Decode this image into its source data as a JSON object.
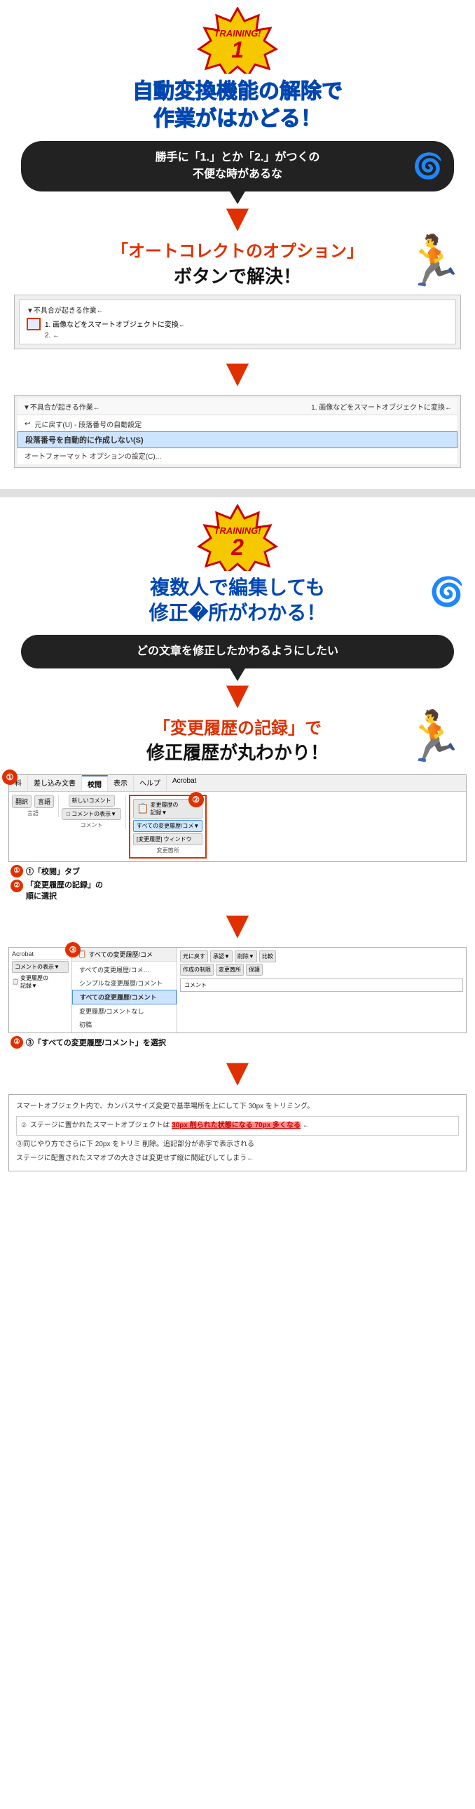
{
  "section1": {
    "badge": {
      "training_label": "TRAINING!",
      "number": "1"
    },
    "title_line1": "自動変換機能の解除で",
    "title_line2": "作業がはかどる！",
    "bubble_text_line1": "勝手に「1.」とか「2.」がつくの",
    "bubble_text_line2": "不便な時があるな",
    "arrow": "▼",
    "solution_line1": "「オートコレクトのオプション」",
    "solution_line2": "ボタンで解決！",
    "screenshot1": {
      "label": "▼不具合が起きる作業←",
      "row1": "1. 画像などをスマートオブジェクトに変換←",
      "row2": "2. ←"
    },
    "screenshot2": {
      "label": "▼不具合が起きる作業←",
      "row1": "1. 画像などをスマートオブジェクトに変換←",
      "menu_items": [
        {
          "text": "元に戻す(U) - 段落番号の自動設定",
          "highlighted": false
        },
        {
          "text": "段落番号を自動的に作成しない(S)",
          "highlighted": true
        },
        {
          "text": "オートフォーマット オプションの設定(C)...",
          "highlighted": false
        }
      ]
    }
  },
  "section2": {
    "badge": {
      "training_label": "TRAINING!",
      "number": "2"
    },
    "title_line1": "複数人で編集しても",
    "title_line2": "修正�所がわかる！",
    "bubble_text": "どの文章を修正したかわるようにしたい",
    "solution_line1": "「変更履歴の記録」で",
    "solution_line2": "修正履歴が丸わかり！",
    "toolbar": {
      "tabs": [
        "校閲",
        "差し込み文書",
        "校閲",
        "表示",
        "ヘルプ",
        "Acrobat"
      ],
      "active_tab": "校閲",
      "groups": {
        "language": {
          "label": "言語",
          "buttons": [
            "翻訳",
            "言語"
          ]
        },
        "comment": {
          "label": "コメント",
          "buttons": [
            "新しいコメント",
            "コメントの表示"
          ]
        },
        "track": {
          "label": "変更箇所",
          "buttons": [
            "変更履歴の記録▼",
            "すべての変更履歴/コメ…",
            "[変更履歴] ウィンドウ"
          ]
        }
      }
    },
    "annotation1": "①「校閲」タブ",
    "annotation2": "②「変更履歴の記録」の\n順に選択",
    "dropdown": {
      "title": "変更履歴の記録▼",
      "items": [
        {
          "text": "すべての変更履歴/コメ…",
          "selected": false
        },
        {
          "text": "シンプルな変更履歴/コメント",
          "selected": false
        },
        {
          "text": "すべての変更履歴/コメント",
          "selected": true
        },
        {
          "text": "変更履歴/コメントなし",
          "selected": false
        },
        {
          "text": "初稿",
          "selected": false
        }
      ],
      "right_buttons": [
        "元に戻す",
        "承認▼",
        "削除▼",
        "比較",
        "作成の制限",
        "変更箇所",
        "保護"
      ]
    },
    "annotation3": "③「すべての変更履歴/コメント」を選択",
    "result": {
      "intro": "スマートオブジェクト内で、カンバスサイズ変更で基準場所を上にして下 30px をトリミング。",
      "highlight_text": "②ステージに置かれたスマートオブジェクトは 30px 削られた状態になる 70px 多くなる←",
      "note1": "③同じやり方でさらに下 20px をトリミ 削除。追記部分が赤字で表示される",
      "note2": "ステージに配置されたスマオブの大きさは変更せず縦に間延びしてしまう←"
    }
  },
  "icons": {
    "red_box": "▣",
    "arrow_down_big": "▼",
    "circled_1": "①",
    "circled_2": "②",
    "circled_3": "③"
  }
}
